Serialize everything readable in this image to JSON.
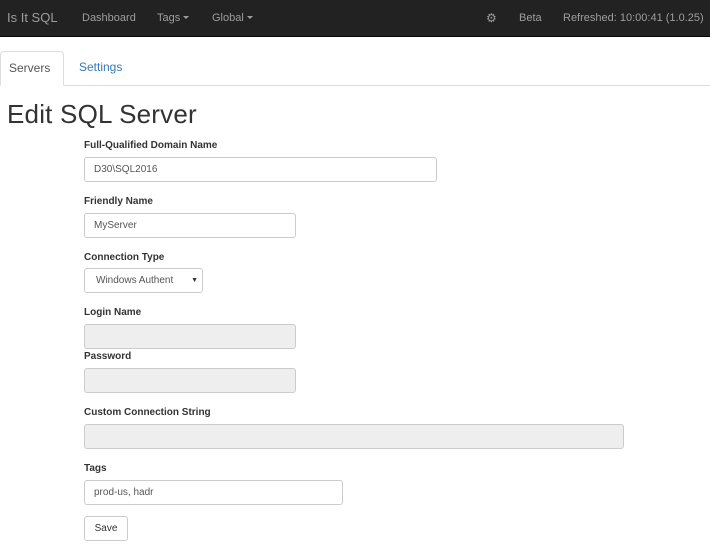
{
  "navbar": {
    "brand": "Is It SQL",
    "items": [
      {
        "label": "Dashboard"
      },
      {
        "label": "Tags"
      },
      {
        "label": "Global"
      }
    ],
    "gear_icon": "gear-icon",
    "beta_label": "Beta",
    "refreshed_text": "Refreshed: 10:00:41 (1.0.25)",
    "background": "#222222",
    "text_color": "#9d9d9d"
  },
  "tabs": [
    {
      "label": "Servers",
      "active": true
    },
    {
      "label": "Settings",
      "active": false
    }
  ],
  "page": {
    "title": "Edit SQL Server"
  },
  "form": {
    "fqdn": {
      "label": "Full-Qualified Domain Name",
      "value": "D30\\SQL2016"
    },
    "friendly_name": {
      "label": "Friendly Name",
      "value": "MyServer"
    },
    "connection_type": {
      "label": "Connection Type",
      "selected": "Windows Authent"
    },
    "login_name": {
      "label": "Login Name",
      "value": ""
    },
    "password": {
      "label": "Password",
      "value": ""
    },
    "custom_connection_string": {
      "label": "Custom Connection String",
      "value": ""
    },
    "tags": {
      "label": "Tags",
      "value": "prod-us, hadr"
    },
    "save_label": "Save"
  },
  "colors": {
    "link": "#337ab7",
    "disabled_field": "#eeeeee"
  }
}
